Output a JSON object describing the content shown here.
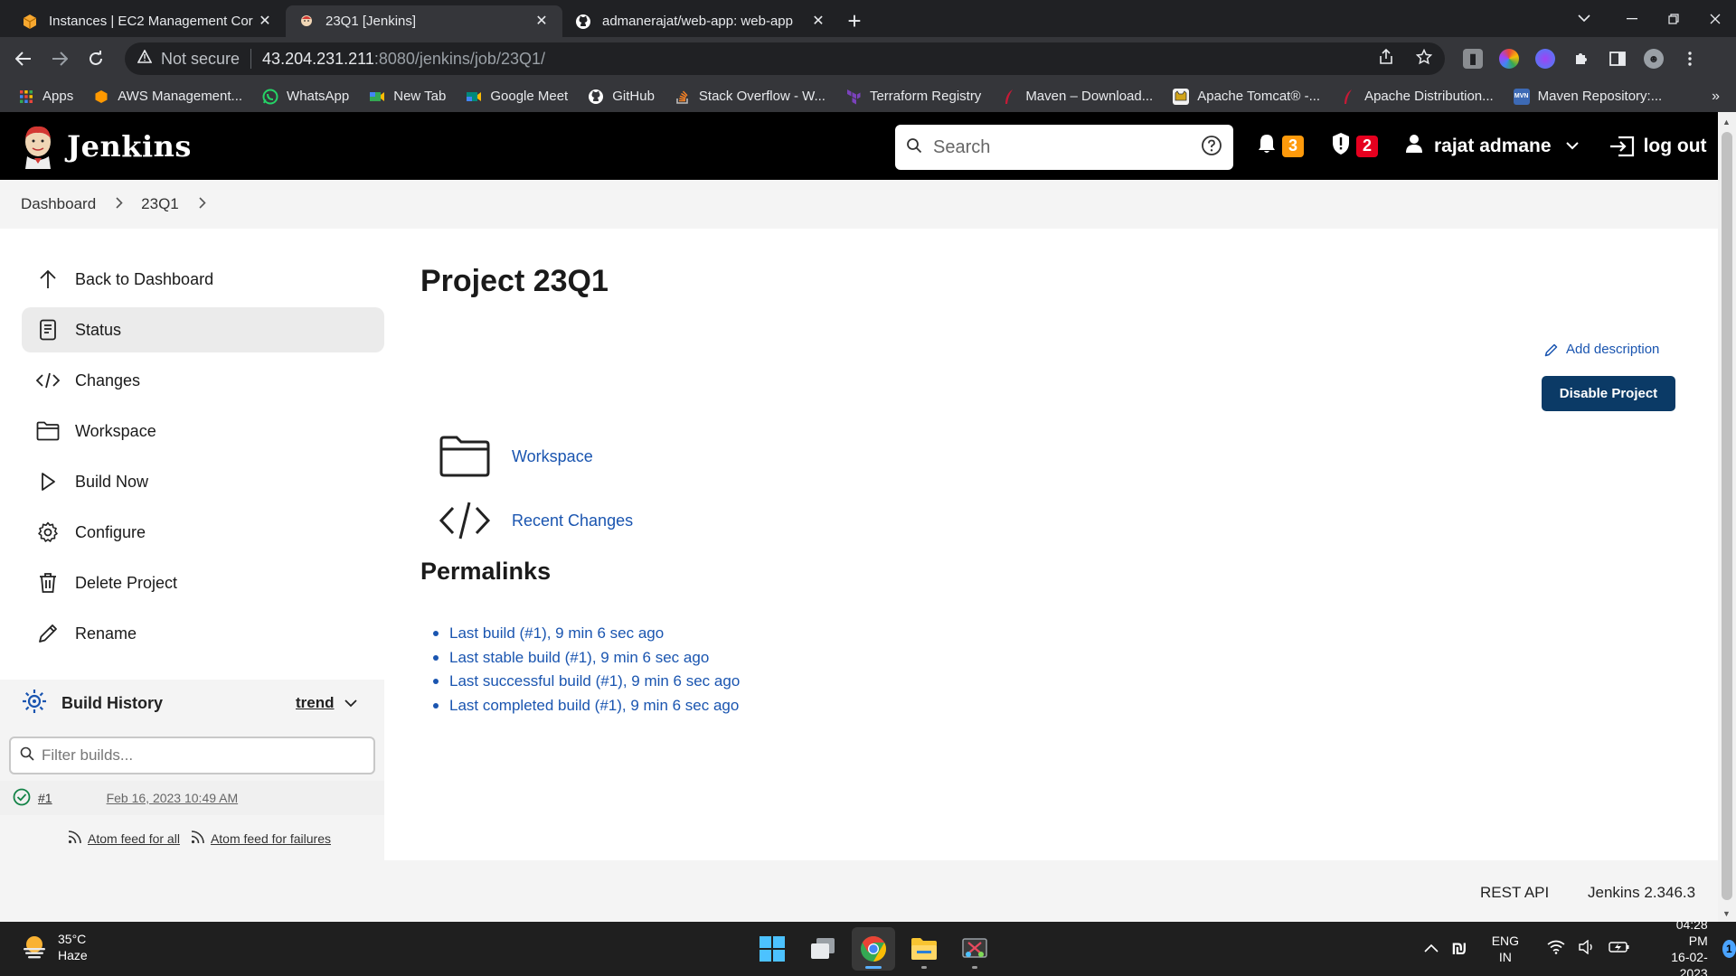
{
  "browser": {
    "tabs": [
      {
        "title": "Instances | EC2 Management Cor",
        "icon": "aws-box-icon",
        "active": false
      },
      {
        "title": "23Q1 [Jenkins]",
        "icon": "jenkins-icon",
        "active": true
      },
      {
        "title": "admanerajat/web-app: web-app",
        "icon": "github-icon",
        "active": false
      }
    ],
    "address": {
      "security_label": "Not secure",
      "host": "43.204.231.211",
      "path": ":8080/jenkins/job/23Q1/"
    },
    "bookmarks": [
      {
        "label": "Apps",
        "icon": "apps-grid-icon",
        "color": "#e8453c"
      },
      {
        "label": "AWS Management...",
        "icon": "aws-icon",
        "color": "#f90"
      },
      {
        "label": "WhatsApp",
        "icon": "whatsapp-icon",
        "color": "#25d366"
      },
      {
        "label": "New Tab",
        "icon": "newtab-icon",
        "color": "#34a853"
      },
      {
        "label": "Google Meet",
        "icon": "meet-icon",
        "color": "#00897b"
      },
      {
        "label": "GitHub",
        "icon": "github-icon",
        "color": "#ffffff"
      },
      {
        "label": "Stack Overflow - W...",
        "icon": "stackoverflow-icon",
        "color": "#f48024"
      },
      {
        "label": "Terraform Registry",
        "icon": "terraform-icon",
        "color": "#7b42bc"
      },
      {
        "label": "Maven – Download...",
        "icon": "maven-icon",
        "color": "#c71a36"
      },
      {
        "label": "Apache Tomcat® -...",
        "icon": "tomcat-icon",
        "color": "#d1a41a"
      },
      {
        "label": "Apache Distribution...",
        "icon": "apache-icon",
        "color": "#c71a36"
      },
      {
        "label": "Maven Repository:...",
        "icon": "mvnrepo-icon",
        "color": "#3d6ab5"
      }
    ]
  },
  "jenkins": {
    "brand": "Jenkins",
    "search_placeholder": "Search",
    "notifications_count": "3",
    "security_count": "2",
    "user_name": "rajat admane",
    "logout_label": "log out",
    "breadcrumb": [
      "Dashboard",
      "23Q1"
    ],
    "side_tasks": [
      {
        "label": "Back to Dashboard",
        "icon": "arrow-up-icon",
        "active": false
      },
      {
        "label": "Status",
        "icon": "document-icon",
        "active": true
      },
      {
        "label": "Changes",
        "icon": "code-icon",
        "active": false
      },
      {
        "label": "Workspace",
        "icon": "folder-icon",
        "active": false
      },
      {
        "label": "Build Now",
        "icon": "play-icon",
        "active": false
      },
      {
        "label": "Configure",
        "icon": "gear-icon",
        "active": false
      },
      {
        "label": "Delete Project",
        "icon": "trash-icon",
        "active": false
      },
      {
        "label": "Rename",
        "icon": "pencil-icon",
        "active": false
      }
    ],
    "build_history": {
      "title": "Build History",
      "trend_label": "trend",
      "filter_placeholder": "Filter builds...",
      "builds": [
        {
          "number": "#1",
          "date": "Feb 16, 2023 10:49 AM",
          "status": "success"
        }
      ],
      "feed_all": "Atom feed for all",
      "feed_failures": "Atom feed for failures"
    },
    "main": {
      "title": "Project 23Q1",
      "add_description": "Add description",
      "disable_button": "Disable Project",
      "workspace_link": "Workspace",
      "recent_changes_link": "Recent Changes",
      "permalinks_title": "Permalinks",
      "permalinks": [
        "Last build (#1), 9 min 6 sec ago",
        "Last stable build (#1), 9 min 6 sec ago",
        "Last successful build (#1), 9 min 6 sec ago",
        "Last completed build (#1), 9 min 6 sec ago"
      ]
    },
    "footer": {
      "rest_api": "REST API",
      "version": "Jenkins 2.346.3"
    }
  },
  "taskbar": {
    "temperature": "35°C",
    "weather": "Haze",
    "lang_top": "ENG",
    "lang_bottom": "IN",
    "time": "04:28 PM",
    "date": "16-02-2023",
    "notification_count": "1"
  }
}
